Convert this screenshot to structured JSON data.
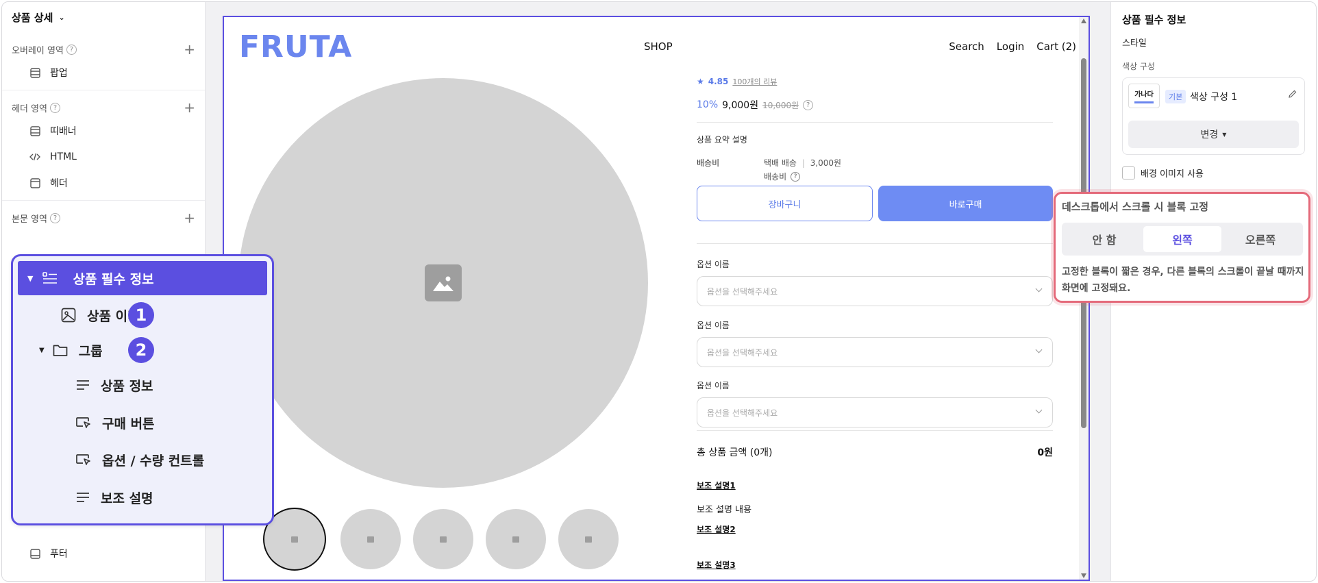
{
  "sidebar": {
    "title": "상품 상세",
    "sections": [
      {
        "title": "오버레이 영역",
        "items": [
          {
            "label": "팝업",
            "icon": "layout-icon"
          }
        ]
      },
      {
        "title": "헤더 영역",
        "items": [
          {
            "label": "띠배너",
            "icon": "layout-icon"
          },
          {
            "label": "HTML",
            "icon": "code-icon"
          },
          {
            "label": "헤더",
            "icon": "layout-icon"
          }
        ]
      },
      {
        "title": "본문 영역",
        "items": []
      }
    ],
    "footer_item": "푸터"
  },
  "tree": {
    "root": "상품 필수 정보",
    "items": [
      {
        "label": "상품 이미지",
        "badge": "1"
      },
      {
        "label": "그룹",
        "badge": "2"
      },
      {
        "label": "상품 정보"
      },
      {
        "label": "구매 버튼"
      },
      {
        "label": "옵션 / 수량 컨트롤"
      },
      {
        "label": "보조 설명"
      }
    ]
  },
  "canvas": {
    "logo": "FRUTA",
    "nav_center": "SHOP",
    "nav_right": [
      "Search",
      "Login",
      "Cart (2)"
    ],
    "rating": {
      "star": "★",
      "score": "4.85",
      "reviews": "100개의 리뷰"
    },
    "price": {
      "discount": "10%",
      "current": "9,000원",
      "original": "10,000원"
    },
    "summary": "상품 요약 설명",
    "shipping": {
      "label": "배송비",
      "method": "택배 배송",
      "separator": "|",
      "amount": "3,000원",
      "note": "배송비"
    },
    "buttons": {
      "cart": "장바구니",
      "buy": "바로구매"
    },
    "options": [
      {
        "label": "옵션 이름",
        "placeholder": "옵션을 선택해주세요"
      },
      {
        "label": "옵션 이름",
        "placeholder": "옵션을 선택해주세요"
      },
      {
        "label": "옵션 이름",
        "placeholder": "옵션을 선택해주세요"
      }
    ],
    "total": {
      "label": "총 상품 금액 (0개)",
      "value": "0원"
    },
    "subdesc": [
      {
        "title": "보조 설명1",
        "body": "보조 설명 내용"
      },
      {
        "title": "보조 설명2"
      },
      {
        "title": "보조 설명3"
      }
    ]
  },
  "right_panel": {
    "title": "상품 필수 정보",
    "style_label": "스타일",
    "color_label": "색상 구성",
    "swatch_text": "가나다",
    "tag": "기본",
    "color_name": "색상 구성 1",
    "change_btn": "변경",
    "bg_image_label": "배경 이미지 사용"
  },
  "sticky": {
    "title": "데스크톱에서 스크롤 시 블록 고정",
    "options": [
      "안 함",
      "왼쪽",
      "오른쪽"
    ],
    "active_index": 1,
    "desc": "고정한 블록이 짧은 경우, 다른 블록의 스크롤이 끝날 때까지 화면에 고정돼요."
  },
  "colors": {
    "accent": "#5b4fe0",
    "brand": "#6b86ee",
    "highlight": "#e46a7a"
  }
}
